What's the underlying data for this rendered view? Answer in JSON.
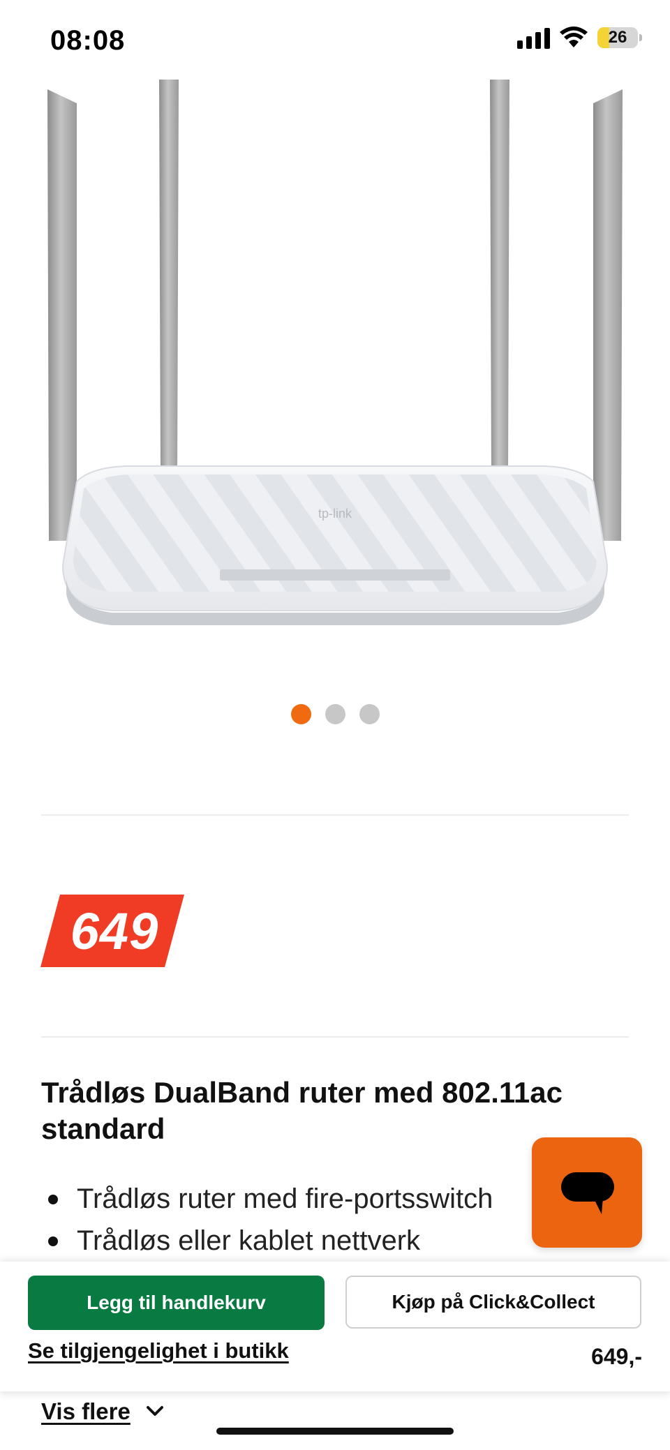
{
  "status_bar": {
    "time": "08:08",
    "battery_level": "26",
    "icons": [
      "signal-icon",
      "wifi-icon",
      "battery-icon"
    ]
  },
  "product_image": {
    "brand_logo": "tp-link"
  },
  "carousel": {
    "total": 3,
    "active_index": 0,
    "active_color": "#ef6a10"
  },
  "price": {
    "amount": "649",
    "badge_color": "#f03c24"
  },
  "product": {
    "title": "Trådløs DualBand ruter med 802.11ac standard",
    "features": [
      "Trådløs ruter med fire-portsswitch",
      "Trådløs eller kablet nettverk"
    ]
  },
  "chat": {
    "icon": "chat-bubble-icon",
    "color": "#ec6410"
  },
  "actions": {
    "add_to_cart_label": "Legg til handlekurv",
    "click_collect_label": "Kjøp på Click&Collect",
    "store_availability_link": "Se tilgjengelighet i butikk",
    "price_label": "649,-",
    "cart_color": "#0a7a43"
  },
  "show_more": {
    "label": "Vis flere",
    "icon": "chevron-down-icon"
  }
}
